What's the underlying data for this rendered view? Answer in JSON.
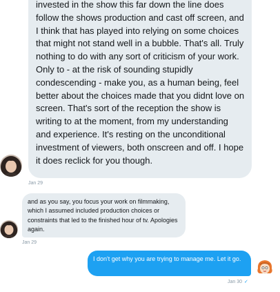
{
  "conversation": {
    "messages": [
      {
        "text": "invested in the show this far down the line does follow the shows production and cast off screen, and I think that has played into relying on some choices that might not stand well in a bubble. That's all. Truly nothing to do with any sort of criticism of your work. Only to - at the risk of sounding stupidly condescending - make you, as a human being, feel better about the choices made that you didnt love on screen. That's sort of the reception the show is writing to at the moment, from my understanding and experience. It's resting on the unconditional investment of viewers, both onscreen and off. I hope it does reclick for you though.",
        "timestamp": "Jan 29"
      },
      {
        "text": "and as you say, you focus your work on filmmaking, which I assumed included production choices or constraints that led to the finished hour of tv. Apologies again.",
        "timestamp": "Jan 29"
      },
      {
        "text": "I don't get why you are trying to manage me. Let it go.",
        "timestamp": "Jan 30",
        "status": "✓"
      }
    ]
  },
  "colors": {
    "incoming_bubble": "#e6ecf0",
    "outgoing_bubble": "#1da1f2",
    "timestamp": "#8899a6"
  },
  "icons": {
    "avatar_incoming": "avatar-dark-curly-hair",
    "avatar_outgoing": "avatar-cartoon-redhead",
    "read_status": "check-icon"
  }
}
